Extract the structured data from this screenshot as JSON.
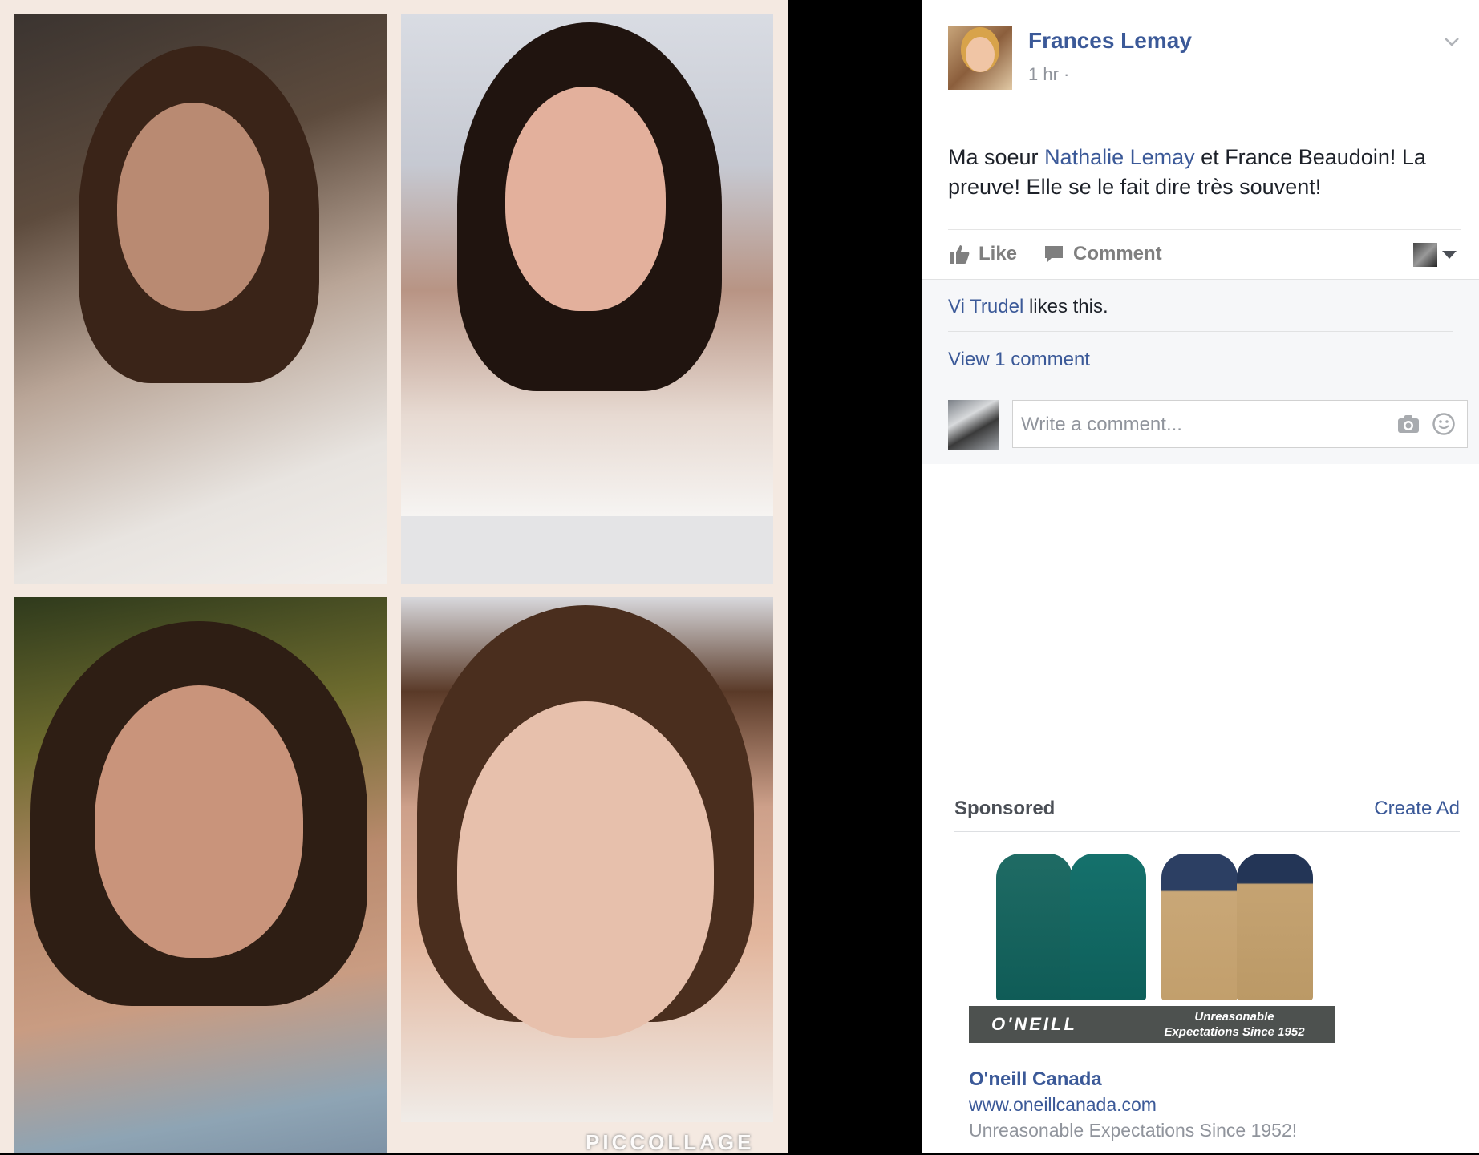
{
  "post": {
    "author": "Frances Lemay",
    "time": "1 hr ·",
    "text_before_link": "Ma soeur ",
    "tagged_person": "Nathalie Lemay",
    "text_after_link": " et France Beaudoin! La preuve! Elle se le fait dire très souvent!",
    "photo_watermark": "PICCOLLAGE"
  },
  "actions": {
    "like_label": "Like",
    "comment_label": "Comment"
  },
  "ufi": {
    "liker_name": "Vi Trudel",
    "likes_suffix": " likes this.",
    "view_comments": "View 1 comment",
    "comment_placeholder": "Write a comment..."
  },
  "sponsored": {
    "title": "Sponsored",
    "create_ad": "Create Ad",
    "ad_brand": "O'NEILL",
    "ad_tagline": "Unreasonable Expectations Since 1952",
    "ad_name": "O'neill Canada",
    "ad_url": "www.oneillcanada.com",
    "ad_description": "Unreasonable Expectations Since 1952!"
  },
  "colors": {
    "link": "#3b5998",
    "muted": "#90949c",
    "ufi_bg": "#f6f7f9"
  }
}
